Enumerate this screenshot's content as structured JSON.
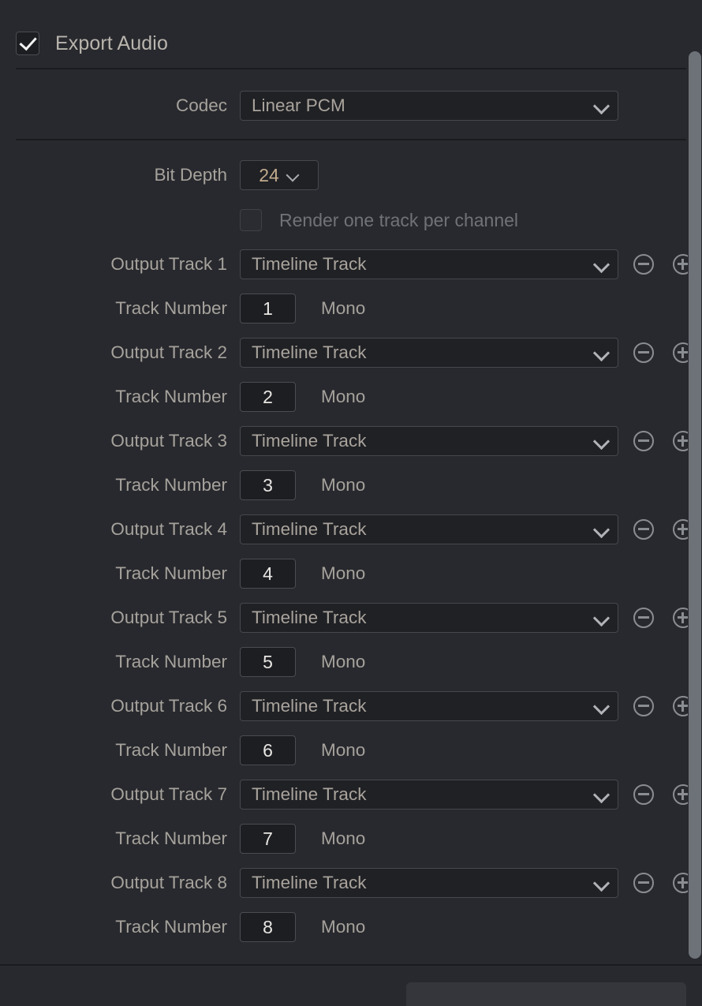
{
  "panel": {
    "export_audio": {
      "label": "Export Audio",
      "checked": true
    },
    "codec": {
      "label": "Codec",
      "value": "Linear PCM"
    },
    "bit_depth": {
      "label": "Bit Depth",
      "value": "24"
    },
    "render_one_track_per_channel": {
      "label": "Render one track per channel",
      "checked": false,
      "enabled": false
    },
    "track_number_label": "Track Number",
    "mono_label": "Mono",
    "minus_icon": "minus-circle-icon",
    "plus_icon": "plus-circle-icon",
    "chevron_icon": "chevron-down-icon",
    "output_tracks": [
      {
        "label": "Output Track 1",
        "source": "Timeline Track",
        "track_number": "1",
        "format": "Mono"
      },
      {
        "label": "Output Track 2",
        "source": "Timeline Track",
        "track_number": "2",
        "format": "Mono"
      },
      {
        "label": "Output Track 3",
        "source": "Timeline Track",
        "track_number": "3",
        "format": "Mono"
      },
      {
        "label": "Output Track 4",
        "source": "Timeline Track",
        "track_number": "4",
        "format": "Mono"
      },
      {
        "label": "Output Track 5",
        "source": "Timeline Track",
        "track_number": "5",
        "format": "Mono"
      },
      {
        "label": "Output Track 6",
        "source": "Timeline Track",
        "track_number": "6",
        "format": "Mono"
      },
      {
        "label": "Output Track 7",
        "source": "Timeline Track",
        "track_number": "7",
        "format": "Mono"
      },
      {
        "label": "Output Track 8",
        "source": "Timeline Track",
        "track_number": "8",
        "format": "Mono"
      }
    ]
  },
  "colors": {
    "background": "#28292e",
    "field_background": "#202125",
    "field_border": "#46484e",
    "label_text": "#a6a29c",
    "value_text": "#a9a39c",
    "disabled_text": "#6f7277",
    "accent_value_text": "#c2ab8e",
    "divider": "#1a1b1f",
    "scrollbar_thumb": "#6d7279"
  }
}
